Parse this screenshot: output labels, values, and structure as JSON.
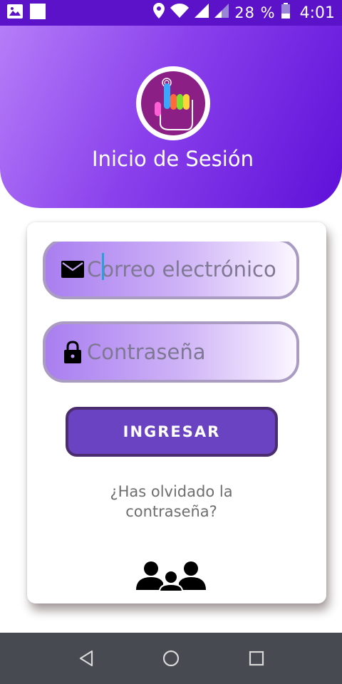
{
  "status_bar": {
    "battery_percent": "28 %",
    "time": "4:01",
    "icons": [
      "image-icon",
      "square-notification-icon",
      "location-icon",
      "wifi-icon",
      "signal-icon",
      "signal-weak-icon",
      "battery-icon"
    ]
  },
  "header": {
    "title": "Inicio de Sesión",
    "logo": "hand-logo",
    "gradient": [
      "#b57df8",
      "#8a41ec",
      "#5f10d8"
    ]
  },
  "login": {
    "email_placeholder": "Correo electrónico",
    "password_placeholder": "Contraseña",
    "submit_label": "INGRESAR",
    "forgot_line1": "¿Has olvidado la",
    "forgot_line2": "contraseña?"
  },
  "footer_icon": "users-group-icon",
  "nav_bar": {
    "buttons": [
      "back-icon",
      "home-icon",
      "recents-icon"
    ]
  },
  "colors": {
    "status_bar": "#5b12c9",
    "button": "#6a43c3",
    "button_border": "#4b2d6f",
    "field_border": "#a99bc2",
    "nav_bar": "#474a51"
  }
}
